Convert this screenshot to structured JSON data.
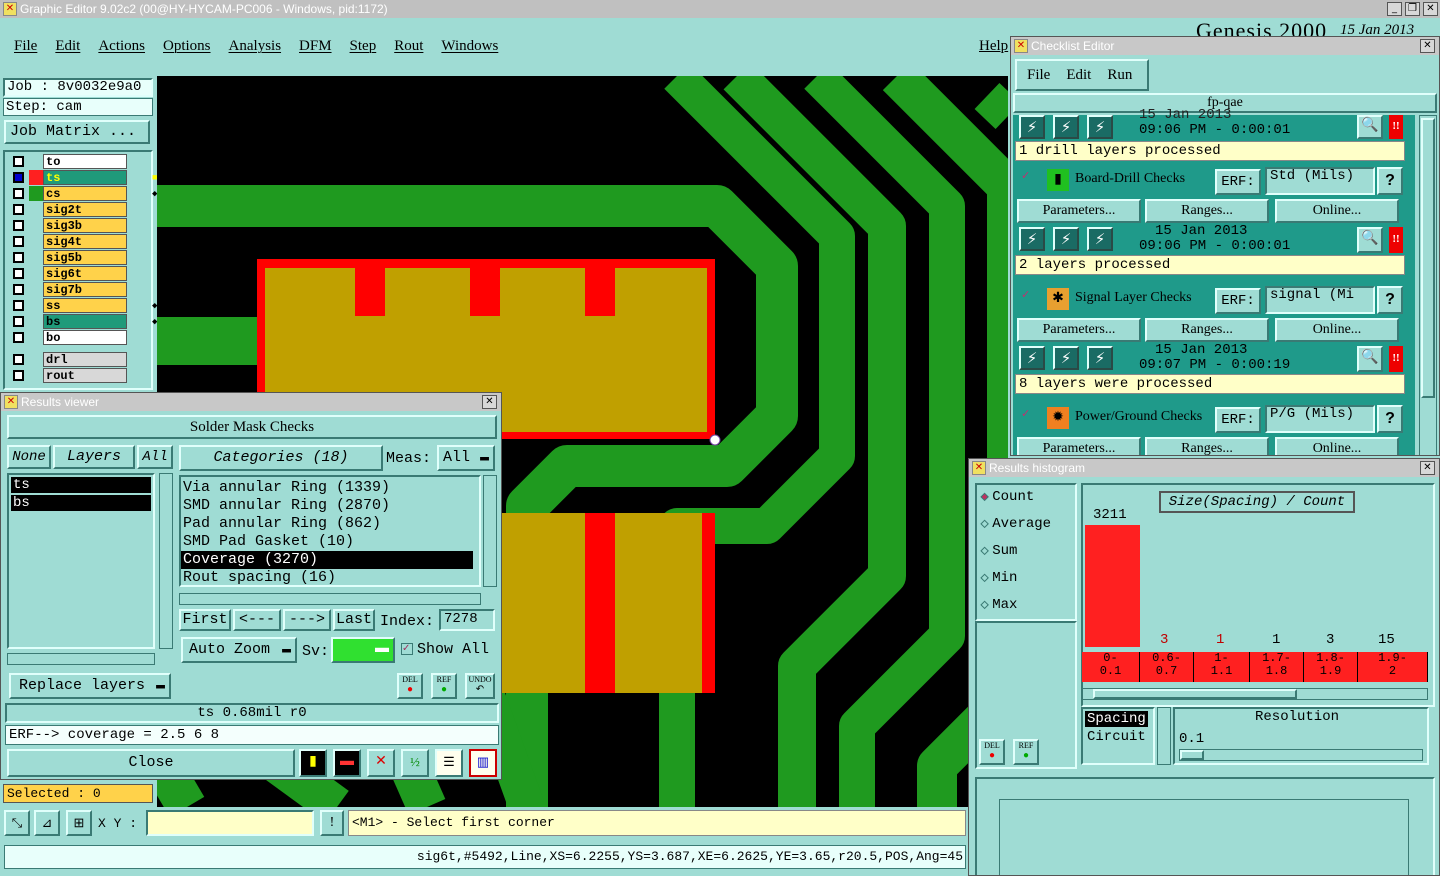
{
  "main_window": {
    "title": "Graphic Editor 9.02c2 (00@HY-HYCAM-PC006 - Windows, pid:1172)",
    "menu": [
      "File",
      "Edit",
      "Actions",
      "Options",
      "Analysis",
      "DFM",
      "Step",
      "Rout",
      "Windows"
    ],
    "help": "Help",
    "bg_brand": "Genesis 2000",
    "bg_date": "15 Jan 2013",
    "job_label": "Job : 8v0032e9a0",
    "step_label": "Step: cam",
    "job_matrix": "Job Matrix ...",
    "layers": [
      {
        "name": "to",
        "color": "#ffffff"
      },
      {
        "name": "ts",
        "color": "#1f9a7a",
        "mark": "■"
      },
      {
        "name": "cs",
        "color": "#ffd24a",
        "mark": "◆"
      },
      {
        "name": "sig2t",
        "color": "#ffd24a"
      },
      {
        "name": "sig3b",
        "color": "#ffd24a"
      },
      {
        "name": "sig4t",
        "color": "#ffd24a"
      },
      {
        "name": "sig5b",
        "color": "#ffd24a"
      },
      {
        "name": "sig6t",
        "color": "#ffd24a"
      },
      {
        "name": "sig7b",
        "color": "#ffd24a"
      },
      {
        "name": "ss",
        "color": "#ffd24a",
        "mark": "◆"
      },
      {
        "name": "bs",
        "color": "#1f9a7a",
        "mark": "◆"
      },
      {
        "name": "bo",
        "color": "#ffffff"
      }
    ],
    "extra_layers": [
      {
        "name": "drl"
      },
      {
        "name": "rout"
      }
    ],
    "selected": "Selected : 0",
    "xy_label": "X Y :",
    "xy_value": "",
    "prompt": "<M1> - Select first corner",
    "status_line": "sig6t,#5492,Line,XS=6.2255,YS=3.687,XE=6.2625,YE=3.65,r20.5,POS,Ang=45"
  },
  "results_viewer": {
    "title": "Results viewer",
    "header": "Solder Mask Checks",
    "btn_none": "None",
    "btn_layers": "Layers",
    "btn_all": "All",
    "layers": [
      "ts",
      "bs"
    ],
    "categories_btn": "Categories (18)",
    "meas_label": "Meas:",
    "meas_value": "All",
    "categories": [
      "Via annular Ring (1339)",
      "SMD annular Ring (2870)",
      "Pad annular Ring (862)",
      "SMD Pad Gasket (10)",
      "Coverage (3270)",
      "Rout spacing (16)"
    ],
    "selected_category": 4,
    "first": "First",
    "prev": "<---",
    "next": "--->",
    "last": "Last",
    "index_label": "Index:",
    "index_value": "7278",
    "auto_zoom": "Auto Zoom",
    "sv_label": "Sv:",
    "show_all": "Show All",
    "replace_layers": "Replace layers",
    "info_line": "ts 0.68mil  r0",
    "erf_line": "ERF--> coverage = 2.5 6 8",
    "close": "Close",
    "del": "DEL",
    "ref": "REF",
    "undo": "UNDO"
  },
  "checklist": {
    "title": "Checklist Editor",
    "menu": [
      "File",
      "Edit",
      "Run"
    ],
    "name": "fp-qae",
    "top_date": "15 Jan 2013",
    "top_time": "09:06 PM - 0:00:01",
    "top_status": "1 drill layers processed",
    "items": [
      {
        "label": "Board-Drill Checks",
        "erf": "Std (Mils)",
        "date": "15 Jan 2013",
        "time": "09:06 PM - 0:00:01",
        "status": "2 layers processed"
      },
      {
        "label": "Signal Layer Checks",
        "erf": "signal (Mi",
        "date": "15 Jan 2013",
        "time": "09:07 PM - 0:00:19",
        "status": "8 layers were processed"
      },
      {
        "label": "Power/Ground Checks",
        "erf": "P/G (Mils)"
      }
    ],
    "erf_label": "ERF:",
    "question": "?",
    "parameters": "Parameters...",
    "ranges": "Ranges...",
    "online": "Online...",
    "alert": "!!"
  },
  "histogram": {
    "title": "Results histogram",
    "options": [
      "Count",
      "Average",
      "Sum",
      "Min",
      "Max"
    ],
    "selected_option": 0,
    "chart_title": "Size(Spacing) / Count",
    "top_value": "3211",
    "counts": [
      "3",
      "1",
      "1",
      "3",
      "15"
    ],
    "bins": [
      "0-\n0.1",
      "0.6-\n0.7",
      "1-\n1.1",
      "1.7-\n1.8",
      "1.8-\n1.9",
      "1.9-\n2"
    ],
    "mode_selected": "Spacing",
    "mode_other": "Circuit",
    "resolution_label": "Resolution",
    "resolution_value": "0.1",
    "del": "DEL",
    "ref": "REF"
  }
}
